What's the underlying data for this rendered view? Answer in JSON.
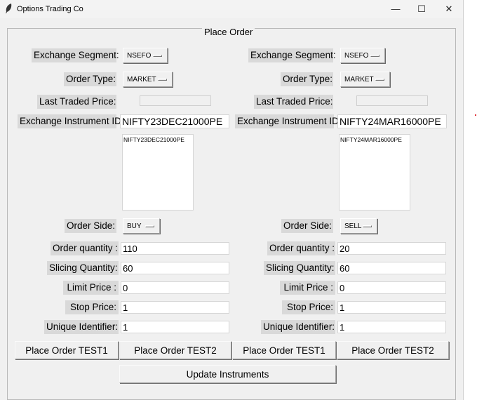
{
  "window": {
    "title": "Options Trading Co",
    "controls": {
      "minimize": "—",
      "maximize": "☐",
      "close": "✕"
    }
  },
  "frame": {
    "label": "Place Order"
  },
  "labels": {
    "exchange_segment": "Exchange Segment:",
    "order_type": "Order Type:",
    "last_traded_price": "Last Traded Price:",
    "exchange_instrument_id": "Exchange Instrument ID",
    "order_side": "Order Side:",
    "order_quantity": "Order quantity :",
    "slicing_quantity": "Slicing Quantity:",
    "limit_price": "Limit Price :",
    "stop_price": "Stop Price:",
    "unique_identifier": "Unique Identifier:"
  },
  "left": {
    "exchange_segment": "NSEFO",
    "order_type": "MARKET",
    "last_traded_price": "",
    "instrument_id": "NIFTY23DEC21000PE",
    "instrument_list": [
      "NIFTY23DEC21000PE"
    ],
    "order_side": "BUY",
    "order_quantity": "110",
    "slicing_quantity": "60",
    "limit_price": "0",
    "stop_price": "1",
    "unique_identifier": "1"
  },
  "right": {
    "exchange_segment": "NSEFO",
    "order_type": "MARKET",
    "last_traded_price": "",
    "instrument_id": "NIFTY24MAR16000PE",
    "instrument_list": [
      "NIFTY24MAR16000PE"
    ],
    "order_side": "SELL",
    "order_quantity": "20",
    "slicing_quantity": "60",
    "limit_price": "0",
    "stop_price": "1",
    "unique_identifier": "1"
  },
  "buttons": {
    "place_order_test1": "Place Order TEST1",
    "place_order_test2": "Place Order TEST2",
    "update_instruments": "Update Instruments"
  },
  "colors": {
    "window_bg": "#f0f0f0",
    "label_bg": "#d9d9d9",
    "accent_dot": "#e0343b"
  }
}
